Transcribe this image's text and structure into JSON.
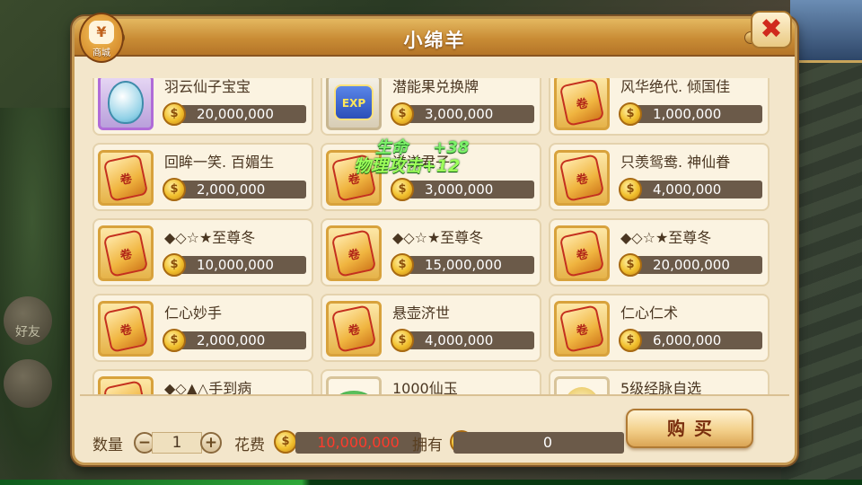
{
  "window": {
    "title": "小绵羊"
  },
  "shop_badge": {
    "icon": "shop-bag-icon",
    "glyph": "¥",
    "label": "商城"
  },
  "side": {
    "friends_label": "好友"
  },
  "items": [
    {
      "name": "羽云仙子宝宝",
      "price": "20,000,000",
      "icon": "pet-egg-icon",
      "frame": "purple"
    },
    {
      "name": "潜能果兑换牌",
      "price": "3,000,000",
      "icon": "exp-card-icon",
      "frame": "exp"
    },
    {
      "name": "风华绝代. 倾国佳",
      "price": "1,000,000",
      "icon": "scroll-icon",
      "frame": "gold"
    },
    {
      "name": "回眸一笑. 百媚生",
      "price": "2,000,000",
      "icon": "scroll-icon",
      "frame": "gold"
    },
    {
      "name": "谦谦君子",
      "price": "3,000,000",
      "icon": "scroll-icon",
      "frame": "gold"
    },
    {
      "name": "只羡鸳鸯. 神仙眷",
      "price": "4,000,000",
      "icon": "scroll-icon",
      "frame": "gold"
    },
    {
      "name": "◆◇☆★至尊冬",
      "price": "10,000,000",
      "icon": "scroll-icon",
      "frame": "gold"
    },
    {
      "name": "◆◇☆★至尊冬",
      "price": "15,000,000",
      "icon": "scroll-icon",
      "frame": "gold"
    },
    {
      "name": "◆◇☆★至尊冬",
      "price": "20,000,000",
      "icon": "scroll-icon",
      "frame": "gold"
    },
    {
      "name": " 仁心妙手",
      "price": "2,000,000",
      "icon": "scroll-icon",
      "frame": "gold"
    },
    {
      "name": "悬壶济世",
      "price": "4,000,000",
      "icon": "scroll-icon",
      "frame": "gold"
    },
    {
      "name": "仁心仁术",
      "price": "6,000,000",
      "icon": "scroll-icon",
      "frame": "gold"
    },
    {
      "name": "◆◇▲△手到病",
      "price": "",
      "icon": "scroll-icon",
      "frame": "gold"
    },
    {
      "name": "1000仙玉",
      "price": "",
      "icon": "jade-icon",
      "frame": "plain"
    },
    {
      "name": "5级经脉自选",
      "price": "",
      "icon": "gold-orb-icon",
      "frame": "plain"
    }
  ],
  "floating_text": [
    {
      "text": "生命",
      "value": "+38"
    },
    {
      "text": "物理攻击",
      "value": "+12"
    }
  ],
  "purchase": {
    "qty_label": "数量",
    "qty_minus": "−",
    "qty_value": "1",
    "qty_plus": "+",
    "cost_label": "花费",
    "cost_value": "10,000,000",
    "own_label": "拥有",
    "own_value": "0",
    "buy_label": "购买"
  },
  "colors": {
    "panel_bg": "#f3e6cb",
    "title_bar": "#c98c35",
    "price_box": "#6b5a49",
    "cost_text": "#ff3b2c",
    "float_text": "#7cf06a"
  }
}
